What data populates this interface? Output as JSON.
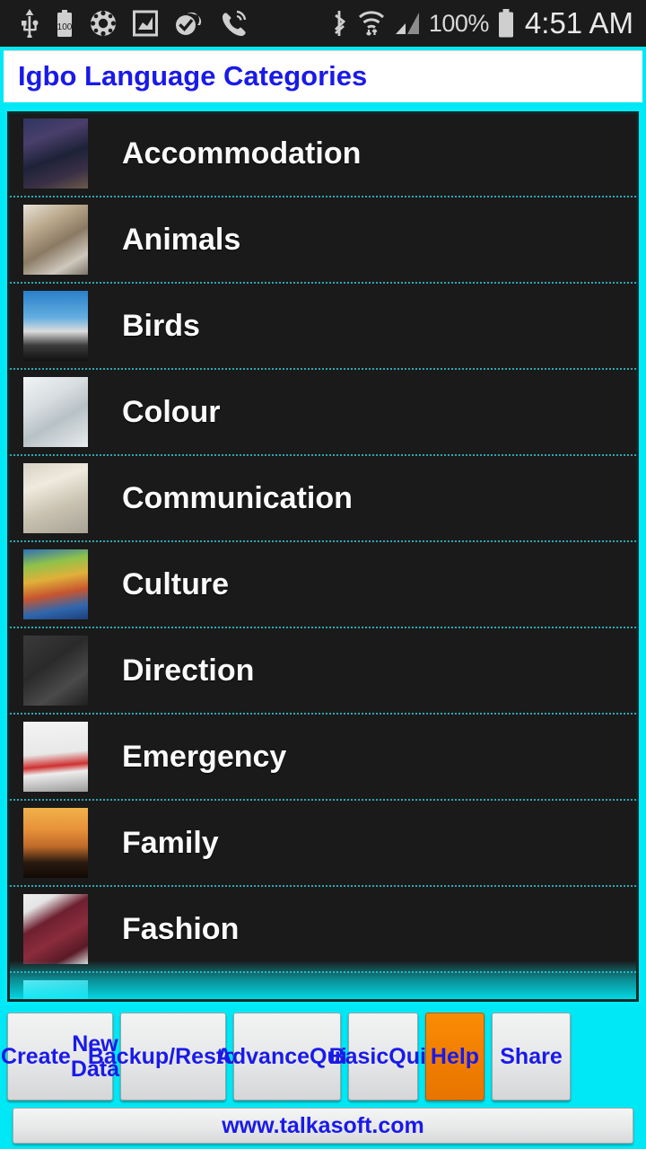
{
  "status_bar": {
    "icons": [
      "usb-icon",
      "battery-saver-100-icon",
      "settings-gear-icon",
      "screenshot-image-icon",
      "checkmark-cloud-icon",
      "call-ringing-icon",
      "bluetooth-icon",
      "wifi-transfer-icon",
      "cellular-signal-icon"
    ],
    "battery_percent": "100%",
    "battery_icon": "battery-full-icon",
    "time": "4:51 AM"
  },
  "header": {
    "title": "Igbo Language Categories",
    "title_color": "#1a1ae8",
    "background_color": "#ffffff"
  },
  "theme": {
    "accent_cyan": "#00e8f5",
    "list_background": "#1a1a1a",
    "separator_color": "#2aa9b5",
    "label_color": "#fafafa",
    "button_text_color": "#1a1ae8",
    "help_button_color": "#f28500"
  },
  "list": {
    "items": [
      {
        "label": "Accommodation",
        "thumb_name": "hotel-building-photo",
        "thumb_css": "linear-gradient(160deg,#2d3560 0%,#4a3f6b 28%,#1d2238 55%,#3a3046 78%,#6b5a4a 100%)"
      },
      {
        "label": "Animals",
        "thumb_name": "cat-photo",
        "thumb_css": "linear-gradient(150deg,#e8e2d8 0%,#b9a88c 30%,#8a7a63 55%,#cfc8bd 80%,#7d7368 100%)"
      },
      {
        "label": "Birds",
        "thumb_name": "bald-eagle-photo",
        "thumb_css": "linear-gradient(180deg,#2a7fc9 0%,#63aee0 38%,#dcdcdc 58%,#3b3b3b 78%,#121212 100%)"
      },
      {
        "label": "Colour",
        "thumb_name": "clouds-photo",
        "thumb_css": "linear-gradient(150deg,#f2f4f5 0%,#d7dde0 35%,#b8c2c6 60%,#e8eced 100%)"
      },
      {
        "label": "Communication",
        "thumb_name": "telephone-photo",
        "thumb_css": "linear-gradient(160deg,#d8d2c4 0%,#efeade 30%,#c9c2b1 62%,#a8a296 100%)"
      },
      {
        "label": "Culture",
        "thumb_name": "cultural-poster-photo",
        "thumb_css": "linear-gradient(170deg,#2d6fb5 0%,#8fc24a 22%,#e0b03a 42%,#c7552f 62%,#2f67ad 82%,#1d3f7a 100%)"
      },
      {
        "label": "Direction",
        "thumb_name": "road-arrow-photo",
        "thumb_css": "linear-gradient(145deg,#3a3a3a 0%,#2a2a2a 40%,#4a4a4a 70%,#1f1f1f 100%)"
      },
      {
        "label": "Emergency",
        "thumb_name": "ambulance-photo",
        "thumb_css": "linear-gradient(175deg,#f4f4f4 0%,#e8e8e8 45%,#cf3030 62%,#ededed 72%,#9a9a9a 100%)"
      },
      {
        "label": "Family",
        "thumb_name": "family-silhouette-sunset-photo",
        "thumb_css": "linear-gradient(180deg,#f0b24a 0%,#e8923a 30%,#c06a2a 55%,#2a1a10 78%,#120a06 100%)"
      },
      {
        "label": "Fashion",
        "thumb_name": "leather-jacket-photo",
        "thumb_css": "linear-gradient(150deg,#efefef 0%,#e4e4e4 18%,#6e2030 38%,#8a2c3c 60%,#5a1a26 82%,#dcdcdc 100%)"
      },
      {
        "label": "",
        "thumb_name": "partially-visible-photo",
        "thumb_css": "linear-gradient(150deg,#cfe8ee 0%,#8fb9c4 45%,#5d8d99 100%)"
      }
    ]
  },
  "buttons": [
    {
      "label": "Create\nNew Data",
      "name": "create-new-data-button",
      "style": "default"
    },
    {
      "label": "Backup/\nRestore",
      "name": "backup-restore-button",
      "style": "default"
    },
    {
      "label": "Advance\nQuiz",
      "name": "advance-quiz-button",
      "style": "default"
    },
    {
      "label": "Basic\nQuiz",
      "name": "basic-quiz-button",
      "style": "default"
    },
    {
      "label": "Help",
      "name": "help-button",
      "style": "orange"
    },
    {
      "label": "Share",
      "name": "share-button",
      "style": "default"
    }
  ],
  "footer": {
    "website": "www.talkasoft.com"
  }
}
